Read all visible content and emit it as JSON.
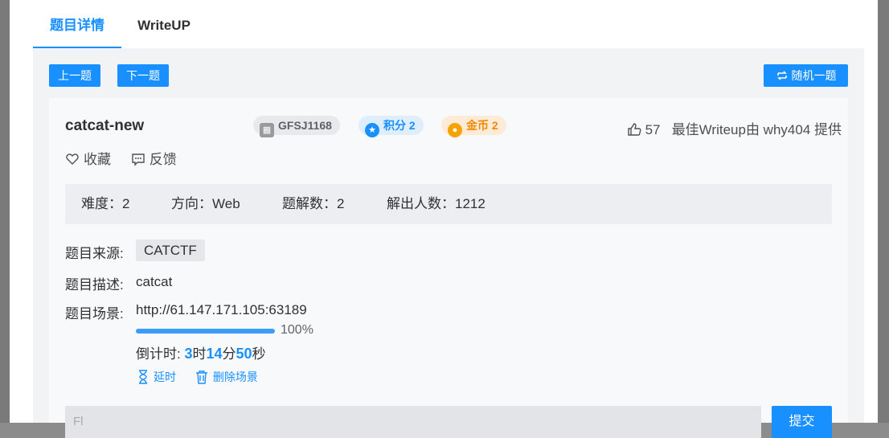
{
  "tabs": [
    "题目详情",
    "WriteUP"
  ],
  "nav": {
    "prev": "上一题",
    "next": "下一题",
    "random": "随机一题"
  },
  "challenge": {
    "title": "catcat-new",
    "id_tag": "GFSJ1168",
    "points": "积分 2",
    "coins": "金币 2",
    "likes": "57",
    "best_writeup": "最佳Writeup由 why404 提供",
    "favorite": "收藏",
    "feedback": "反馈"
  },
  "stats": {
    "difficulty": "难度：2",
    "direction": "方向：Web",
    "solutions": "题解数：2",
    "solvers": "解出人数：1212"
  },
  "details": {
    "source_label": "题目来源:",
    "source_value": "CATCTF",
    "desc_label": "题目描述:",
    "desc_value": "catcat",
    "scene_label": "题目场景:",
    "scene_url": "http://61.147.171.105:63189",
    "progress_text": "100%",
    "progress_value": 1.0,
    "countdown_prefix": "倒计时: ",
    "countdown_h": "3",
    "countdown_h_unit": "时",
    "countdown_m": "14",
    "countdown_m_unit": "分",
    "countdown_s": "50",
    "countdown_s_unit": "秒",
    "extend": "延时",
    "delete_scene": "删除场景"
  },
  "flag": {
    "placeholder": "Fl",
    "submit": "提交"
  },
  "colors": {
    "accent": "#1890ff",
    "coin": "#f08a00"
  }
}
